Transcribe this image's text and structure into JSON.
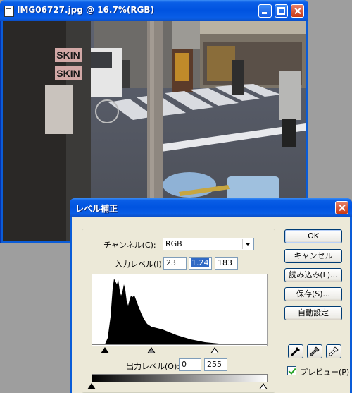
{
  "image_window": {
    "title": "IMG06727.jpg @ 16.7%(RGB)",
    "controls": [
      "minimize-icon",
      "maximize-icon",
      "close-icon"
    ]
  },
  "photo": {
    "signs": {
      "skin_top": "SKIN",
      "skin_bottom": "SKIN"
    }
  },
  "dialog": {
    "title": "レベル補正",
    "channel_label": "チャンネル(C):",
    "channel_value": "RGB",
    "input_label": "入力レベル(I):",
    "input_levels": [
      "23",
      "1.24",
      "183"
    ],
    "output_label": "出力レベル(O):",
    "output_levels": [
      "0",
      "255"
    ],
    "buttons": {
      "ok": "OK",
      "cancel": "キャンセル",
      "load": "読み込み(L)...",
      "save": "保存(S)...",
      "auto": "自動設定"
    },
    "eyedroppers": [
      "black-eyedropper-icon",
      "gray-eyedropper-icon",
      "white-eyedropper-icon"
    ],
    "preview_label": "プレビュー(P)",
    "preview_checked": true,
    "colors": {
      "titlebar": "#0a5cd8",
      "close": "#c93813",
      "face": "#ece9d8"
    }
  }
}
